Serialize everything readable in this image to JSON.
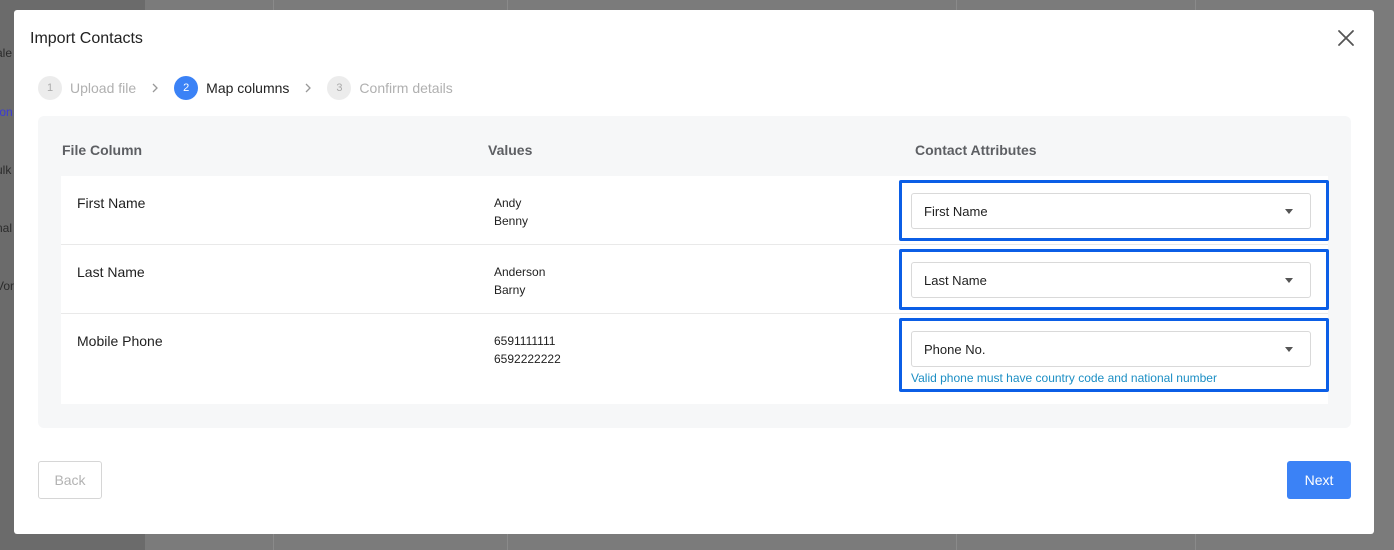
{
  "background": {
    "fragments": [
      "ale",
      "ton",
      "ulk",
      "nal",
      "Vor"
    ]
  },
  "modal": {
    "title": "Import Contacts",
    "close_icon": "close-icon"
  },
  "stepper": {
    "steps": [
      {
        "number": "1",
        "label": "Upload file",
        "state": "done"
      },
      {
        "number": "2",
        "label": "Map columns",
        "state": "active"
      },
      {
        "number": "3",
        "label": "Confirm details",
        "state": "pending"
      }
    ],
    "separator_icon": "chevron-right-icon"
  },
  "mapping": {
    "headers": {
      "file_column": "File Column",
      "values": "Values",
      "contact_attributes": "Contact Attributes"
    },
    "rows": [
      {
        "file_column": "First Name",
        "values": [
          "Andy",
          "Benny"
        ],
        "attribute": "First Name",
        "helper": ""
      },
      {
        "file_column": "Last Name",
        "values": [
          "Anderson",
          "Barny"
        ],
        "attribute": "Last Name",
        "helper": ""
      },
      {
        "file_column": "Mobile Phone",
        "values": [
          "6591111111",
          "6592222222"
        ],
        "attribute": "Phone No.",
        "helper": "Valid phone must have country code and national number"
      }
    ]
  },
  "footer": {
    "back_label": "Back",
    "next_label": "Next"
  },
  "colors": {
    "accent": "#3b82f6",
    "highlight_border": "#0b5ee6",
    "helper_text": "#1b8ec4",
    "overlay": "#7b7b7b"
  }
}
